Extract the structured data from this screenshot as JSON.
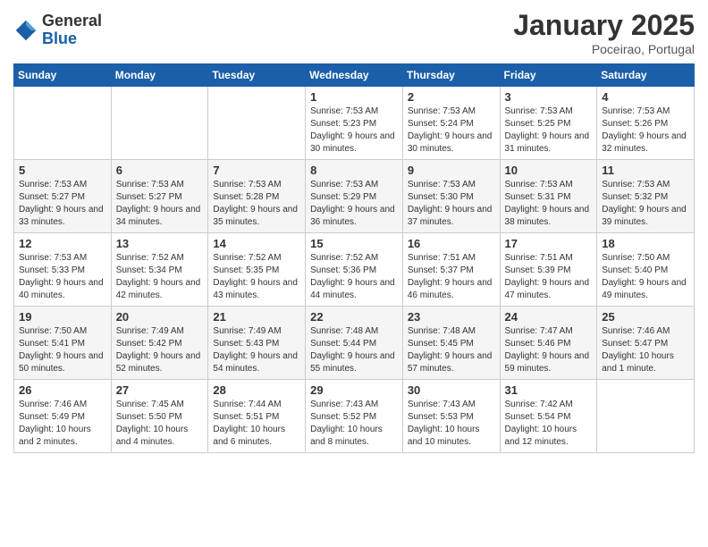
{
  "header": {
    "logo_general": "General",
    "logo_blue": "Blue",
    "month": "January 2025",
    "location": "Poceirao, Portugal"
  },
  "weekdays": [
    "Sunday",
    "Monday",
    "Tuesday",
    "Wednesday",
    "Thursday",
    "Friday",
    "Saturday"
  ],
  "weeks": [
    [
      {
        "day": "",
        "sunrise": "",
        "sunset": "",
        "daylight": ""
      },
      {
        "day": "",
        "sunrise": "",
        "sunset": "",
        "daylight": ""
      },
      {
        "day": "",
        "sunrise": "",
        "sunset": "",
        "daylight": ""
      },
      {
        "day": "1",
        "sunrise": "Sunrise: 7:53 AM",
        "sunset": "Sunset: 5:23 PM",
        "daylight": "Daylight: 9 hours and 30 minutes."
      },
      {
        "day": "2",
        "sunrise": "Sunrise: 7:53 AM",
        "sunset": "Sunset: 5:24 PM",
        "daylight": "Daylight: 9 hours and 30 minutes."
      },
      {
        "day": "3",
        "sunrise": "Sunrise: 7:53 AM",
        "sunset": "Sunset: 5:25 PM",
        "daylight": "Daylight: 9 hours and 31 minutes."
      },
      {
        "day": "4",
        "sunrise": "Sunrise: 7:53 AM",
        "sunset": "Sunset: 5:26 PM",
        "daylight": "Daylight: 9 hours and 32 minutes."
      }
    ],
    [
      {
        "day": "5",
        "sunrise": "Sunrise: 7:53 AM",
        "sunset": "Sunset: 5:27 PM",
        "daylight": "Daylight: 9 hours and 33 minutes."
      },
      {
        "day": "6",
        "sunrise": "Sunrise: 7:53 AM",
        "sunset": "Sunset: 5:27 PM",
        "daylight": "Daylight: 9 hours and 34 minutes."
      },
      {
        "day": "7",
        "sunrise": "Sunrise: 7:53 AM",
        "sunset": "Sunset: 5:28 PM",
        "daylight": "Daylight: 9 hours and 35 minutes."
      },
      {
        "day": "8",
        "sunrise": "Sunrise: 7:53 AM",
        "sunset": "Sunset: 5:29 PM",
        "daylight": "Daylight: 9 hours and 36 minutes."
      },
      {
        "day": "9",
        "sunrise": "Sunrise: 7:53 AM",
        "sunset": "Sunset: 5:30 PM",
        "daylight": "Daylight: 9 hours and 37 minutes."
      },
      {
        "day": "10",
        "sunrise": "Sunrise: 7:53 AM",
        "sunset": "Sunset: 5:31 PM",
        "daylight": "Daylight: 9 hours and 38 minutes."
      },
      {
        "day": "11",
        "sunrise": "Sunrise: 7:53 AM",
        "sunset": "Sunset: 5:32 PM",
        "daylight": "Daylight: 9 hours and 39 minutes."
      }
    ],
    [
      {
        "day": "12",
        "sunrise": "Sunrise: 7:53 AM",
        "sunset": "Sunset: 5:33 PM",
        "daylight": "Daylight: 9 hours and 40 minutes."
      },
      {
        "day": "13",
        "sunrise": "Sunrise: 7:52 AM",
        "sunset": "Sunset: 5:34 PM",
        "daylight": "Daylight: 9 hours and 42 minutes."
      },
      {
        "day": "14",
        "sunrise": "Sunrise: 7:52 AM",
        "sunset": "Sunset: 5:35 PM",
        "daylight": "Daylight: 9 hours and 43 minutes."
      },
      {
        "day": "15",
        "sunrise": "Sunrise: 7:52 AM",
        "sunset": "Sunset: 5:36 PM",
        "daylight": "Daylight: 9 hours and 44 minutes."
      },
      {
        "day": "16",
        "sunrise": "Sunrise: 7:51 AM",
        "sunset": "Sunset: 5:37 PM",
        "daylight": "Daylight: 9 hours and 46 minutes."
      },
      {
        "day": "17",
        "sunrise": "Sunrise: 7:51 AM",
        "sunset": "Sunset: 5:39 PM",
        "daylight": "Daylight: 9 hours and 47 minutes."
      },
      {
        "day": "18",
        "sunrise": "Sunrise: 7:50 AM",
        "sunset": "Sunset: 5:40 PM",
        "daylight": "Daylight: 9 hours and 49 minutes."
      }
    ],
    [
      {
        "day": "19",
        "sunrise": "Sunrise: 7:50 AM",
        "sunset": "Sunset: 5:41 PM",
        "daylight": "Daylight: 9 hours and 50 minutes."
      },
      {
        "day": "20",
        "sunrise": "Sunrise: 7:49 AM",
        "sunset": "Sunset: 5:42 PM",
        "daylight": "Daylight: 9 hours and 52 minutes."
      },
      {
        "day": "21",
        "sunrise": "Sunrise: 7:49 AM",
        "sunset": "Sunset: 5:43 PM",
        "daylight": "Daylight: 9 hours and 54 minutes."
      },
      {
        "day": "22",
        "sunrise": "Sunrise: 7:48 AM",
        "sunset": "Sunset: 5:44 PM",
        "daylight": "Daylight: 9 hours and 55 minutes."
      },
      {
        "day": "23",
        "sunrise": "Sunrise: 7:48 AM",
        "sunset": "Sunset: 5:45 PM",
        "daylight": "Daylight: 9 hours and 57 minutes."
      },
      {
        "day": "24",
        "sunrise": "Sunrise: 7:47 AM",
        "sunset": "Sunset: 5:46 PM",
        "daylight": "Daylight: 9 hours and 59 minutes."
      },
      {
        "day": "25",
        "sunrise": "Sunrise: 7:46 AM",
        "sunset": "Sunset: 5:47 PM",
        "daylight": "Daylight: 10 hours and 1 minute."
      }
    ],
    [
      {
        "day": "26",
        "sunrise": "Sunrise: 7:46 AM",
        "sunset": "Sunset: 5:49 PM",
        "daylight": "Daylight: 10 hours and 2 minutes."
      },
      {
        "day": "27",
        "sunrise": "Sunrise: 7:45 AM",
        "sunset": "Sunset: 5:50 PM",
        "daylight": "Daylight: 10 hours and 4 minutes."
      },
      {
        "day": "28",
        "sunrise": "Sunrise: 7:44 AM",
        "sunset": "Sunset: 5:51 PM",
        "daylight": "Daylight: 10 hours and 6 minutes."
      },
      {
        "day": "29",
        "sunrise": "Sunrise: 7:43 AM",
        "sunset": "Sunset: 5:52 PM",
        "daylight": "Daylight: 10 hours and 8 minutes."
      },
      {
        "day": "30",
        "sunrise": "Sunrise: 7:43 AM",
        "sunset": "Sunset: 5:53 PM",
        "daylight": "Daylight: 10 hours and 10 minutes."
      },
      {
        "day": "31",
        "sunrise": "Sunrise: 7:42 AM",
        "sunset": "Sunset: 5:54 PM",
        "daylight": "Daylight: 10 hours and 12 minutes."
      },
      {
        "day": "",
        "sunrise": "",
        "sunset": "",
        "daylight": ""
      }
    ]
  ]
}
